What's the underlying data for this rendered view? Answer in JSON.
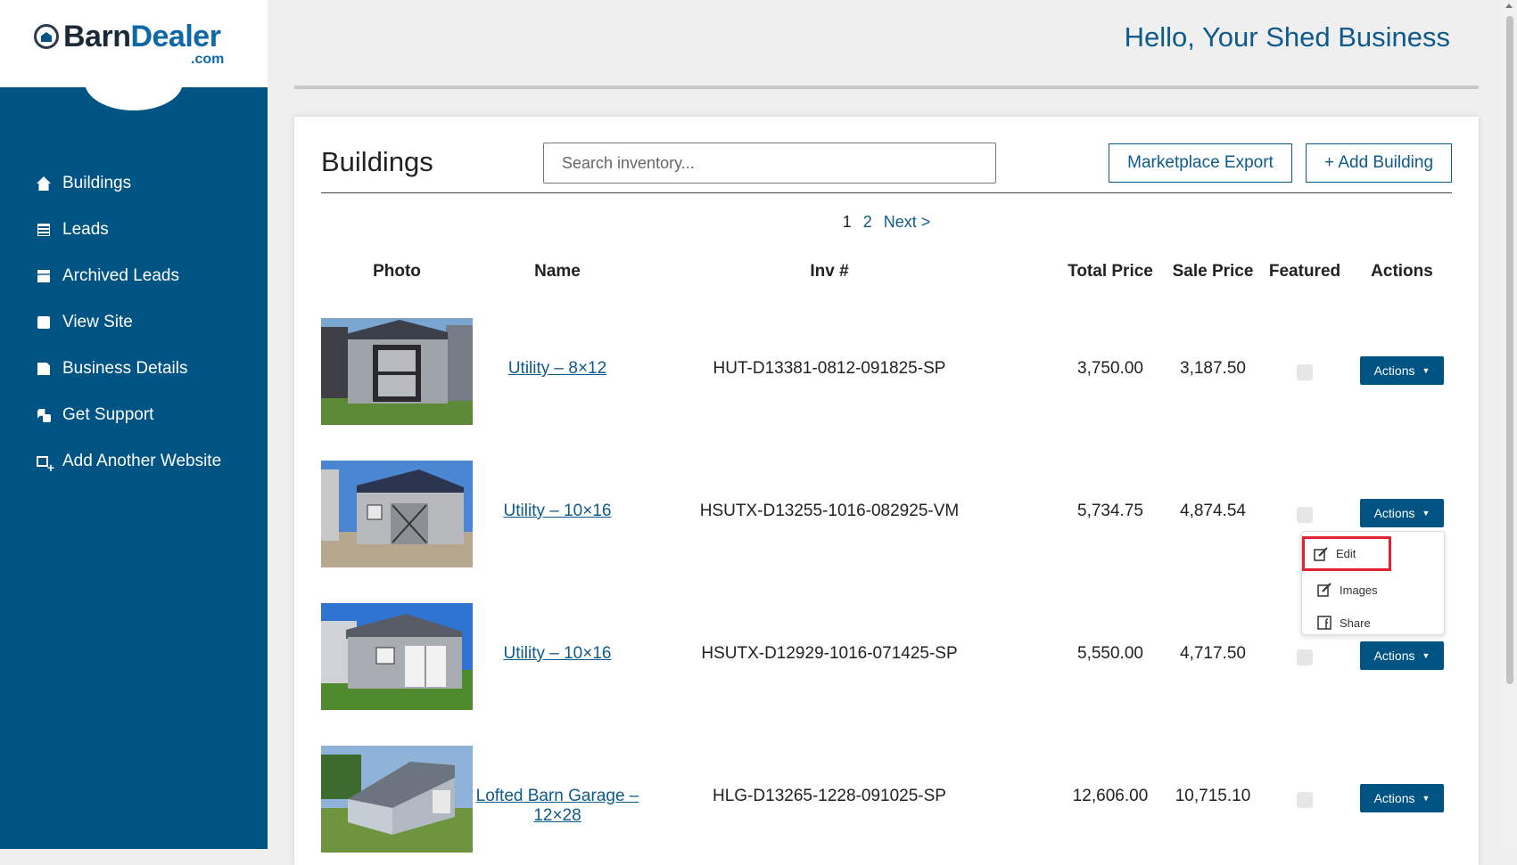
{
  "brand": {
    "barn": "Barn",
    "dealer": "Dealer",
    "com": ".com"
  },
  "header": {
    "greeting": "Hello, Your Shed Business"
  },
  "sidebar": {
    "items": [
      {
        "label": "Buildings",
        "icon": "home-icon"
      },
      {
        "label": "Leads",
        "icon": "list-icon"
      },
      {
        "label": "Archived Leads",
        "icon": "archive-icon"
      },
      {
        "label": "View Site",
        "icon": "eye-icon"
      },
      {
        "label": "Business Details",
        "icon": "document-icon"
      },
      {
        "label": "Get Support",
        "icon": "chat-icon"
      },
      {
        "label": "Add Another Website",
        "icon": "add-window-icon"
      }
    ]
  },
  "main": {
    "title": "Buildings",
    "search_placeholder": "Search inventory...",
    "export_label": "Marketplace Export",
    "add_label": "+ Add Building",
    "pager": {
      "p1": "1",
      "p2": "2",
      "next": "Next >"
    },
    "columns": {
      "photo": "Photo",
      "name": "Name",
      "inv": "Inv #",
      "total": "Total Price",
      "sale": "Sale Price",
      "featured": "Featured",
      "actions": "Actions"
    },
    "rows": [
      {
        "name": "Utility – 8×12",
        "inv": "HUT-D13381-0812-091825-SP",
        "total": "3,750.00",
        "sale": "3,187.50",
        "action": "Actions"
      },
      {
        "name": "Utility – 10×16",
        "inv": "HSUTX-D13255-1016-082925-VM",
        "total": "5,734.75",
        "sale": "4,874.54",
        "action": "Actions"
      },
      {
        "name": "Utility – 10×16",
        "inv": "HSUTX-D12929-1016-071425-SP",
        "total": "5,550.00",
        "sale": "4,717.50",
        "action": "Actions"
      },
      {
        "name": "Lofted Barn Garage – 12×28",
        "inv": "HLG-D13265-1228-091025-SP",
        "total": "12,606.00",
        "sale": "10,715.10",
        "action": "Actions"
      }
    ],
    "dropdown": {
      "edit": "Edit",
      "images": "Images",
      "share": "Share"
    }
  }
}
